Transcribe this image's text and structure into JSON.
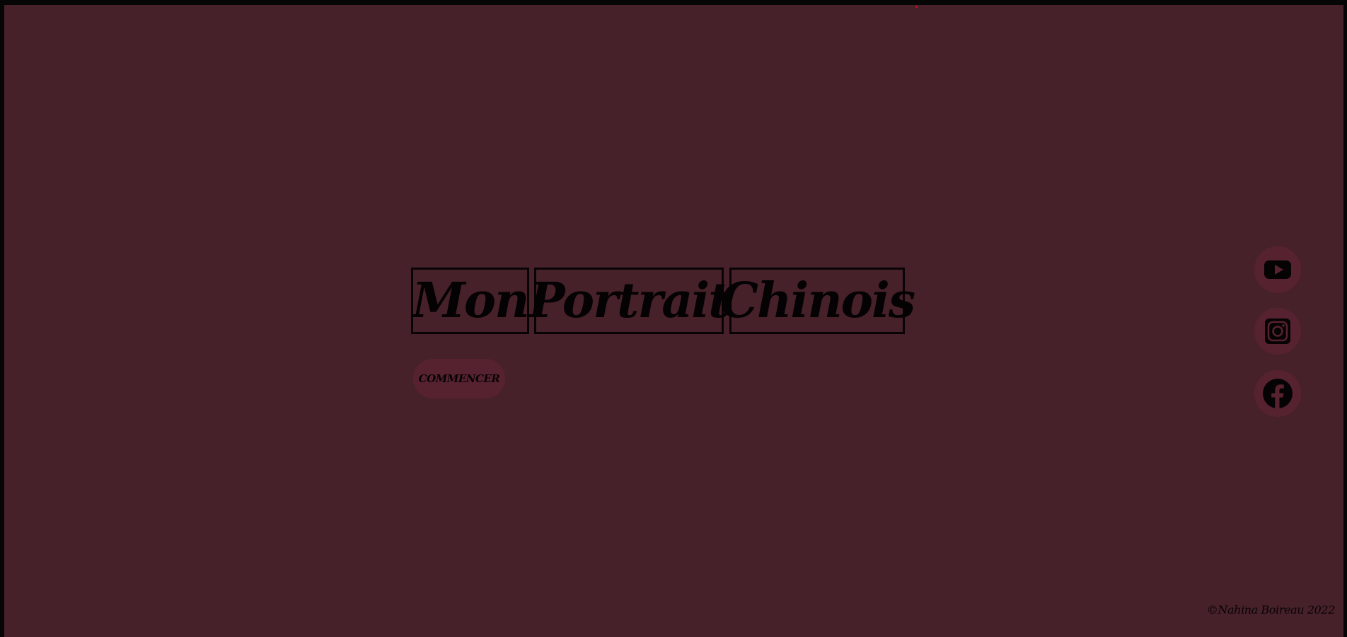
{
  "hero": {
    "words": [
      "Mon",
      "Portrait",
      "Chinois"
    ],
    "start_label": "COMMENCER"
  },
  "social": {
    "items": [
      {
        "name": "youtube",
        "icon": "youtube-icon"
      },
      {
        "name": "instagram",
        "icon": "instagram-icon"
      },
      {
        "name": "facebook",
        "icon": "facebook-icon"
      }
    ]
  },
  "footer": {
    "copyright": "©Nahina Boireau 2022"
  },
  "colors": {
    "background": "#47212a",
    "button": "#57222f",
    "text": "#050203",
    "accent_dot": "#c0142a"
  }
}
